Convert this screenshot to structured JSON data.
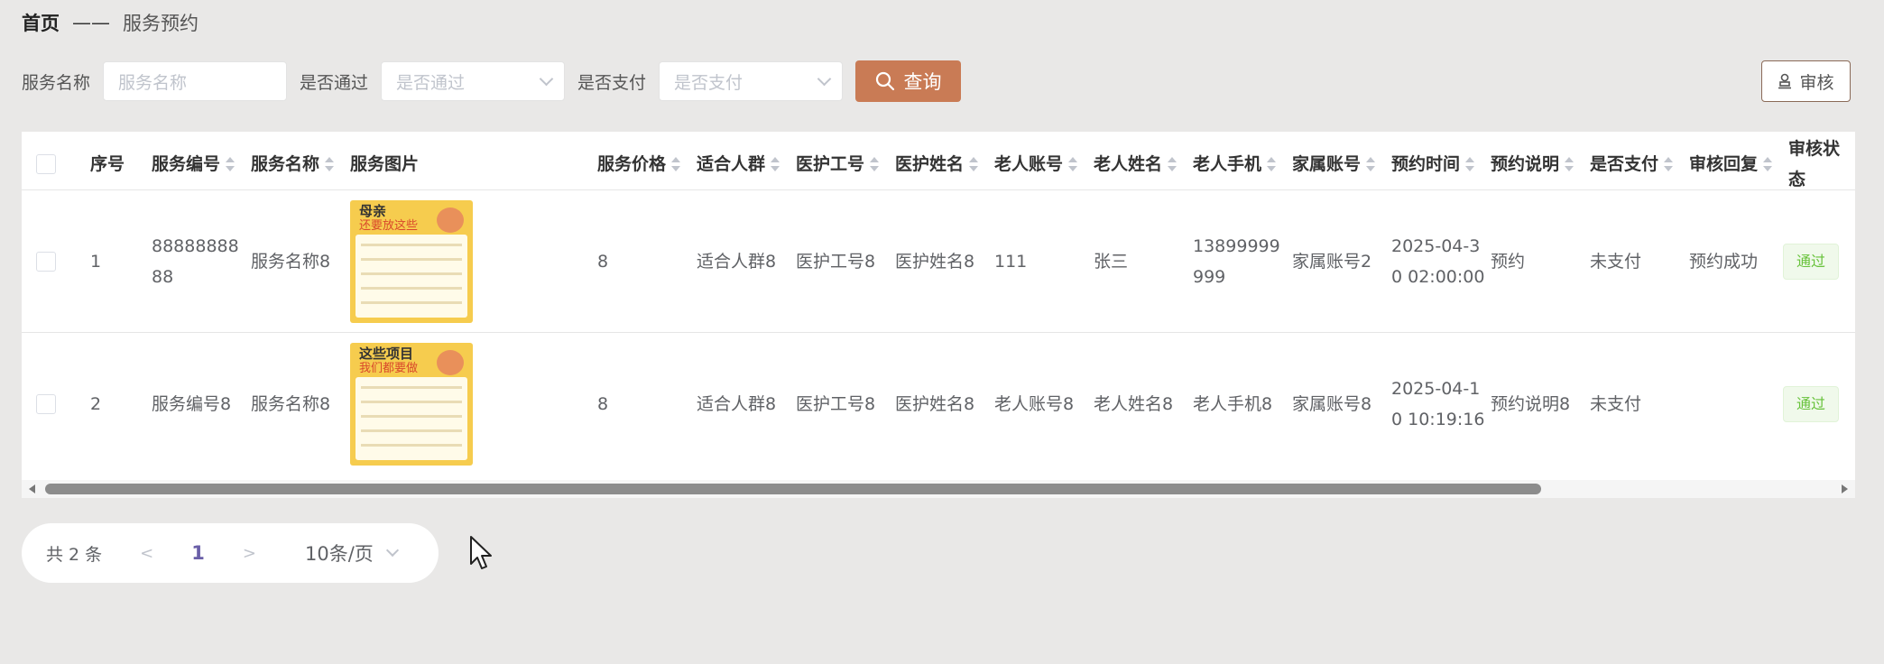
{
  "breadcrumb": {
    "home": "首页",
    "separator": "——",
    "current": "服务预约"
  },
  "filters": {
    "service_name": {
      "label": "服务名称",
      "placeholder": "服务名称"
    },
    "approved": {
      "label": "是否通过",
      "placeholder": "是否通过"
    },
    "paid": {
      "label": "是否支付",
      "placeholder": "是否支付"
    },
    "query_label": "查询"
  },
  "audit_button": "审核",
  "table": {
    "headers": [
      "序号",
      "服务编号",
      "服务名称",
      "服务图片",
      "服务价格",
      "适合人群",
      "医护工号",
      "医护姓名",
      "老人账号",
      "老人姓名",
      "老人手机",
      "家属账号",
      "预约时间",
      "预约说明",
      "是否支付",
      "审核回复",
      "审核状态"
    ],
    "rows": [
      {
        "index": "1",
        "service_no": "8888888888",
        "service_name": "服务名称8",
        "image": {
          "title": "母亲",
          "subtitle": "还要放这些"
        },
        "price": "8",
        "crowd": "适合人群8",
        "staff_no": "医护工号8",
        "staff_name": "医护姓名8",
        "elder_account": "111",
        "elder_name": "张三",
        "elder_phone": "13899999999",
        "family_account": "家属账号2",
        "time": "2025-04-30 02:00:00",
        "note": "预约",
        "paid": "未支付",
        "reply": "预约成功",
        "status": "通过"
      },
      {
        "index": "2",
        "service_no": "服务编号8",
        "service_name": "服务名称8",
        "image": {
          "title": "这些项目",
          "subtitle": "我们都要做"
        },
        "price": "8",
        "crowd": "适合人群8",
        "staff_no": "医护工号8",
        "staff_name": "医护姓名8",
        "elder_account": "老人账号8",
        "elder_name": "老人姓名8",
        "elder_phone": "老人手机8",
        "family_account": "家属账号8",
        "time": "2025-04-10 10:19:16",
        "note": "预约说明8",
        "paid": "未支付",
        "reply": "",
        "status": "通过"
      }
    ]
  },
  "pagination": {
    "total": "共 2 条",
    "prev": "<",
    "page": "1",
    "next": ">",
    "page_size": "10条/页"
  },
  "colors": {
    "accent": "#c97b55",
    "page_bg": "#e9e8e7",
    "success": "#67c23a"
  }
}
